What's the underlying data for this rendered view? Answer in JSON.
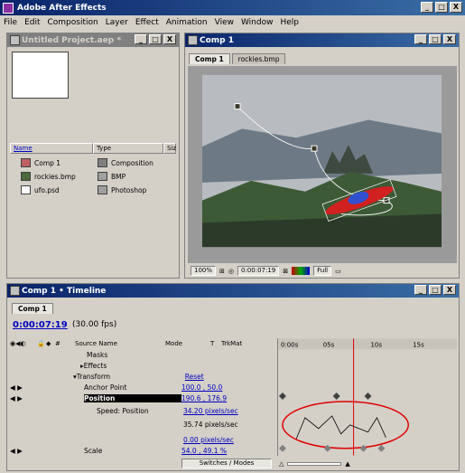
{
  "app": {
    "title": "Adobe After Effects",
    "window_buttons": [
      "_",
      "□",
      "X"
    ]
  },
  "menu": [
    "File",
    "Edit",
    "Composition",
    "Layer",
    "Effect",
    "Animation",
    "View",
    "Window",
    "Help"
  ],
  "project_panel": {
    "title": "Untitled Project.aep *",
    "columns": [
      "Name",
      "Type",
      "Siz"
    ],
    "items": [
      {
        "name": "Comp 1",
        "type": "Composition",
        "icon": "composition-icon"
      },
      {
        "name": "rockies.bmp",
        "type": "BMP",
        "icon": "bmp-image-icon"
      },
      {
        "name": "ufo.psd",
        "type": "Photoshop",
        "icon": "photoshop-file-icon"
      }
    ]
  },
  "comp_panel": {
    "title": "Comp 1",
    "tabs": [
      "Comp 1",
      "rockies.bmp"
    ],
    "zoom": "100%",
    "timecode": "0:00:07:19",
    "resolution": "Full"
  },
  "timeline_panel": {
    "title": "Comp 1 • Timeline",
    "tab": "Comp 1",
    "current_time": "0:00:07:19",
    "fps": "(30.00 fps)",
    "columns": [
      "Source Name",
      "Mode",
      "T",
      "TrkMat"
    ],
    "ruler_labels": [
      "0:00s",
      "05s",
      "10s",
      "15s"
    ],
    "rows": [
      {
        "label": "Masks",
        "value": ""
      },
      {
        "label": "Effects",
        "value": ""
      },
      {
        "label": "Transform",
        "value": "Reset"
      },
      {
        "label": "Anchor Point",
        "value": "100.0 , 50.0"
      },
      {
        "label": "Position",
        "value": "190.6 , 176.9"
      },
      {
        "label": "Speed: Position",
        "value": "34.20 pixels/sec"
      },
      {
        "label": "",
        "value": "35.74 pixels/sec"
      },
      {
        "label": "",
        "value": "0.00 pixels/sec"
      },
      {
        "label": "Scale",
        "value": "54.0 , 49.1 %"
      }
    ],
    "switches_label": "Switches / Modes"
  },
  "colors": {
    "title_active": "#0a246a",
    "panel_bg": "#d4d0c8",
    "timecode_blue": "#0000a0",
    "highlight_red": "#e00000"
  }
}
